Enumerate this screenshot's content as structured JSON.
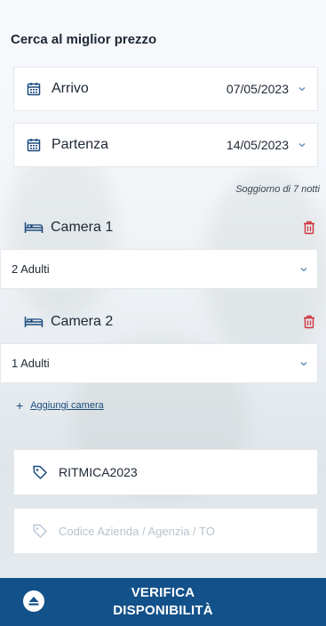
{
  "search": {
    "title": "Cerca al miglior prezzo"
  },
  "arrival": {
    "label": "Arrivo",
    "date": "07/05/2023"
  },
  "departure": {
    "label": "Partenza",
    "date": "14/05/2023"
  },
  "stay_note": "Soggiorno di 7 notti",
  "rooms": [
    {
      "name": "Camera 1",
      "guests": "2 Adulti"
    },
    {
      "name": "Camera 2",
      "guests": "1 Adulti"
    }
  ],
  "add_room_label": "Aggiungi camera",
  "promo_code": {
    "value": "RITMICA2023"
  },
  "company_code": {
    "placeholder": "Codice Azienda / Agenzia / TO"
  },
  "cta": {
    "line1": "VERIFICA",
    "line2": "DISPONIBILITÀ"
  },
  "colors": {
    "primary": "#13518a",
    "danger": "#d2303a",
    "icon": "#1b4b7d"
  }
}
